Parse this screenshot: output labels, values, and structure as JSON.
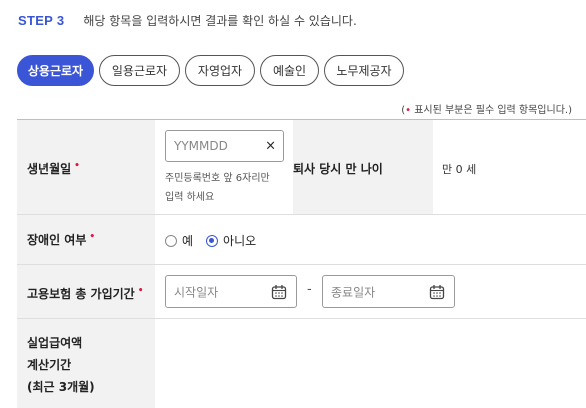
{
  "step": {
    "label": "STEP 3",
    "description": "해당 항목을 입력하시면 결과를 확인 하실 수 있습니다."
  },
  "tabs": [
    {
      "label": "상용근로자",
      "active": true
    },
    {
      "label": "일용근로자",
      "active": false
    },
    {
      "label": "자영업자",
      "active": false
    },
    {
      "label": "예술인",
      "active": false
    },
    {
      "label": "노무제공자",
      "active": false
    }
  ],
  "required_note": {
    "open": "(",
    "dot": "•",
    "text": " 표시된 부분은 필수 입력 항목입니다.)"
  },
  "form": {
    "birth": {
      "label": "생년월일",
      "placeholder": "YYMMDD",
      "value": "",
      "hint_line1": "주민등록번호 앞 6자리만",
      "hint_line2": "입력 하세요",
      "age_label": "퇴사 당시 만 나이",
      "age_value": "만 0 세"
    },
    "disability": {
      "label": "장애인 여부",
      "options": [
        "예",
        "아니오"
      ],
      "selected": "아니오"
    },
    "insurance_period": {
      "label": "고용보험 총 가입기간",
      "start_placeholder": "시작일자",
      "separator": "-",
      "end_placeholder": "종료일자"
    },
    "benefit_period": {
      "label_line1": "실업급여액",
      "label_line2": "계산기간",
      "label_line3": "(최근 3개월)"
    }
  },
  "required_mark": "•",
  "clear_symbol": "×",
  "icons": {
    "clear": "close-icon",
    "calendar": "calendar-icon"
  },
  "colors": {
    "accent": "#3a55d6",
    "required": "#e0163e"
  }
}
